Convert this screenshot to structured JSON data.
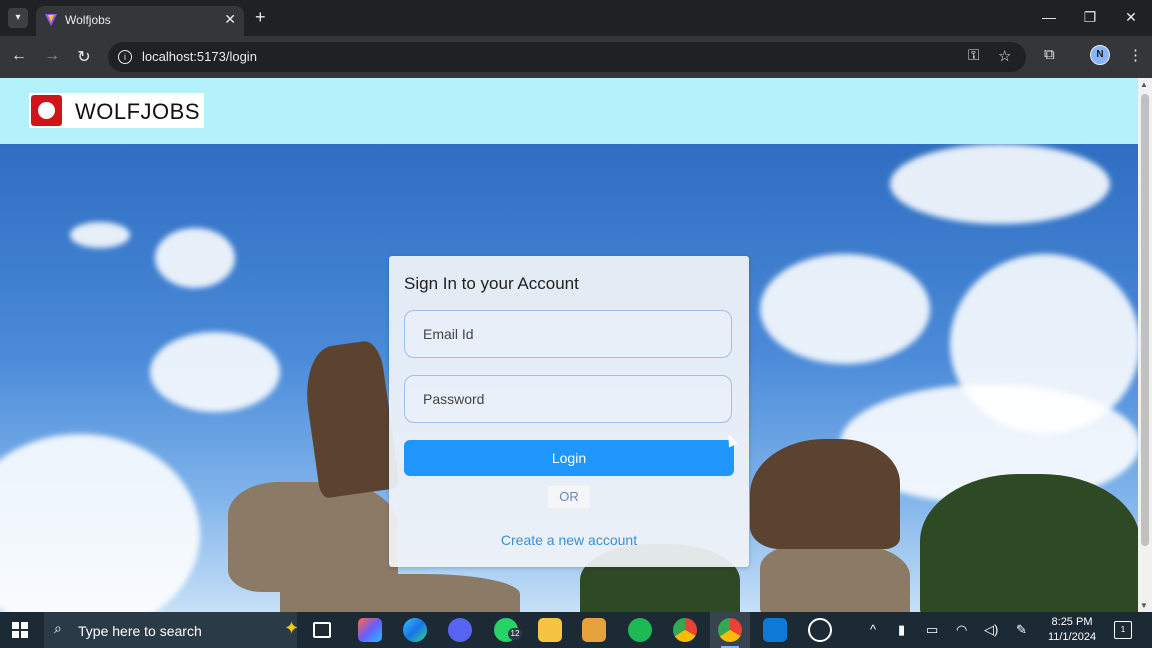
{
  "browser": {
    "tab_title": "Wolfjobs",
    "url": "localhost:5173/login"
  },
  "navbar": {
    "brand_name": "WOLFJOBS"
  },
  "login": {
    "title": "Sign In to your Account",
    "email_placeholder": "Email Id",
    "password_placeholder": "Password",
    "login_label": "Login",
    "or_label": "OR",
    "create_account_label": "Create a new account"
  },
  "taskbar": {
    "search_placeholder": "Type here to search",
    "whatsapp_badge": "12",
    "time": "8:25 PM",
    "date": "11/1/2024",
    "notification_count": "1"
  },
  "colors": {
    "navbar_bg": "#b3f2fb",
    "login_button": "#1e96fc",
    "link": "#3b8fd4",
    "brand_logo": "#d1141c"
  },
  "icons": [
    "tab-search-icon",
    "close-icon",
    "plus-icon",
    "minimize-icon",
    "maximize-icon",
    "back-icon",
    "forward-icon",
    "reload-icon",
    "info-icon",
    "key-icon",
    "star-icon",
    "extensions-icon",
    "profile-icon",
    "menu-icon",
    "windows-start-icon",
    "search-icon",
    "copilot-icon"
  ]
}
